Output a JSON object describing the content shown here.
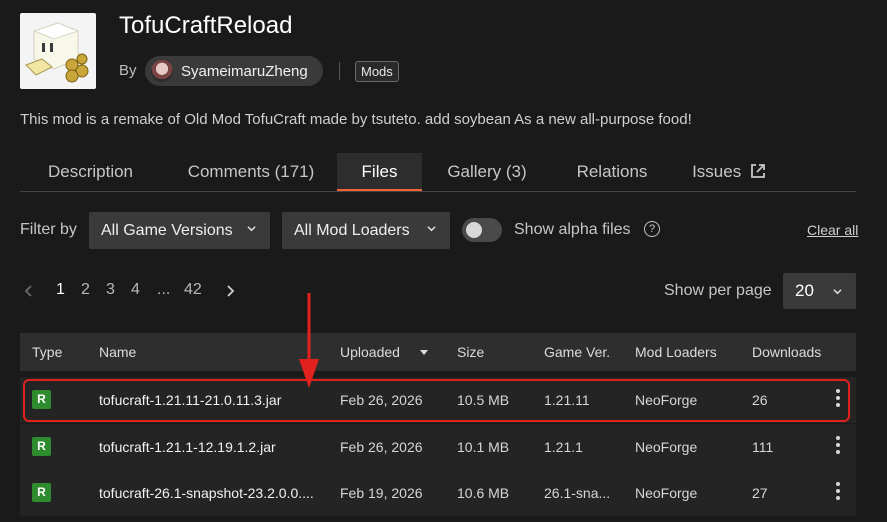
{
  "project": {
    "title": "TofuCraftReload",
    "by_label": "By",
    "author": "SyameimaruZheng",
    "category_tag": "Mods",
    "description": "This mod is a remake of Old Mod TofuCraft made by tsuteto. add soybean As a new all-purpose food!"
  },
  "tabs": [
    {
      "label": "Description"
    },
    {
      "label": "Comments (171)"
    },
    {
      "label": "Files"
    },
    {
      "label": "Gallery (3)"
    },
    {
      "label": "Relations"
    },
    {
      "label": "Issues"
    }
  ],
  "active_tab": "Files",
  "filters": {
    "label": "Filter by",
    "game_versions": "All Game Versions",
    "mod_loaders": "All Mod Loaders",
    "alpha_toggle_on": false,
    "alpha_label": "Show alpha files",
    "help_glyph": "?",
    "clear_all": "Clear all"
  },
  "pagination": {
    "pages": [
      "1",
      "2",
      "3",
      "4",
      "...",
      "42"
    ],
    "current": "1",
    "per_page_label": "Show per page",
    "per_page_value": "20"
  },
  "table": {
    "headers": {
      "type": "Type",
      "name": "Name",
      "uploaded": "Uploaded",
      "size": "Size",
      "game_ver": "Game Ver.",
      "mod_loaders": "Mod Loaders",
      "downloads": "Downloads"
    },
    "rows": [
      {
        "type": "R",
        "name": "tofucraft-1.21.11-21.0.11.3.jar",
        "uploaded": "Feb 26, 2026",
        "size": "10.5 MB",
        "game_ver": "1.21.11",
        "loader": "NeoForge",
        "downloads": "26"
      },
      {
        "type": "R",
        "name": "tofucraft-1.21.1-12.19.1.2.jar",
        "uploaded": "Feb 26, 2026",
        "size": "10.1 MB",
        "game_ver": "1.21.1",
        "loader": "NeoForge",
        "downloads": "111"
      },
      {
        "type": "R",
        "name": "tofucraft-26.1-snapshot-23.2.0.0....",
        "uploaded": "Feb 19, 2026",
        "size": "10.6 MB",
        "game_ver": "26.1-sna...",
        "loader": "NeoForge",
        "downloads": "27"
      }
    ]
  },
  "colors": {
    "accent": "#f16436",
    "release_badge": "#2e8b2e",
    "annotation": "#e0211d"
  },
  "icons": {
    "external_link": "external-link-icon",
    "chevron": "chevron-down-icon",
    "prev": "chevron-left-icon",
    "next": "chevron-right-icon",
    "help": "help-circle-icon",
    "sort": "sort-desc-icon",
    "more": "kebab-menu-icon"
  }
}
